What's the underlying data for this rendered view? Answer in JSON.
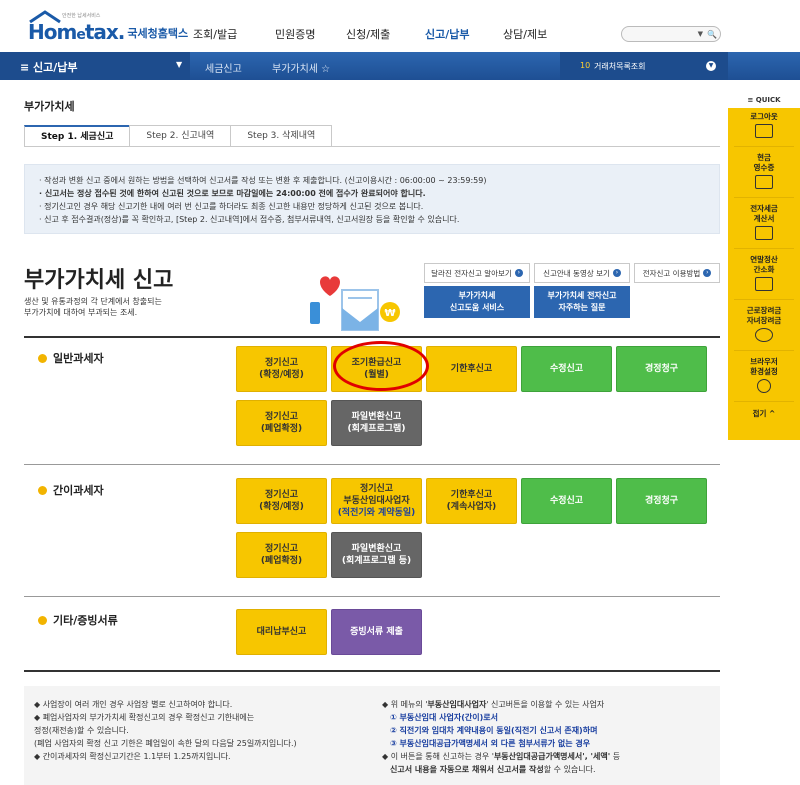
{
  "header": {
    "logo_tag": "안전한 납세서비스",
    "logo_home": "Hom",
    "logo_e": "e",
    "logo_tax": "tax.",
    "logo_sub": "국세청홈택스",
    "nav": [
      "조회/발급",
      "민원증명",
      "신청/제출",
      "신고/납부",
      "상담/제보"
    ],
    "search_placeholder": ""
  },
  "bluebar": {
    "menu_label": "≡  신고/납부",
    "crumbs": [
      "세금신고",
      "부가가치세 ☆"
    ],
    "count": "10",
    "lookup_label": "거래처목록조회"
  },
  "page_title": "부가가치세",
  "tabs": [
    "Step 1. 세금신고",
    "Step 2. 신고내역",
    "Step 3. 삭제내역"
  ],
  "notice": [
    "· 작성과 변환 신고 중에서 원하는 방법을 선택하여 신고서를 작성 또는 변환 후 제출합니다. (신고이용시간 : 06:00:00 ~ 23:59:59)",
    "· 신고서는 정상 접수된 것에 한하여 신고된 것으로 보므로 마감일에는 24:00:00 전에 접수가 완료되어야 합니다.",
    "· 정기신고인 경우 해당 신고기한 내에 여러 번 신고를 하더라도 최종 신고한 내용만 정당하게 신고된 것으로 봅니다.",
    "· 신고 후 접수결과(정상)를 꼭 확인하고, [Step 2. 신고내역]에서 접수증, 첨부서류내역, 신고서원장 등을 확인할 수 있습니다."
  ],
  "vat": {
    "title": "부가가치세 신고",
    "desc_lines": [
      "생산 및 유통과정의 각 단계에서 창출되는",
      "부가가치에 대하여 부과되는 조세."
    ],
    "links": [
      "달라진 전자신고 알아보기",
      "신고안내 동영상 보기",
      "전자신고 이용방법"
    ],
    "blue_buttons": [
      [
        "부가가치세",
        "신고도움 서비스"
      ],
      [
        "부가가치세 전자신고",
        "자주하는 질문"
      ]
    ]
  },
  "sections": {
    "general": {
      "title": "일반과세자",
      "buttons": [
        [
          "정기신고",
          "(확정/예정)"
        ],
        [
          "조기환급신고",
          "(월별)"
        ],
        [
          "기한후신고"
        ],
        [
          "수정신고"
        ],
        [
          "경정청구"
        ],
        [
          "정기신고",
          "(폐업확정)"
        ],
        [
          "파일변환신고",
          "(회계프로그램)"
        ]
      ]
    },
    "simple": {
      "title": "간이과세자",
      "buttons": [
        [
          "정기신고",
          "(확정/예정)"
        ],
        [
          "정기신고",
          "부동산임대사업자",
          "(적전기와 계약동일)"
        ],
        [
          "기한후신고",
          "(계속사업자)"
        ],
        [
          "수정신고"
        ],
        [
          "경정청구"
        ],
        [
          "정기신고",
          "(폐업확정)"
        ],
        [
          "파일변환신고",
          "(회계프로그램 등)"
        ]
      ]
    },
    "other": {
      "title": "기타/증빙서류",
      "buttons": [
        [
          "대리납부신고"
        ],
        [
          "증빙서류 제출"
        ]
      ]
    }
  },
  "bottom_left": [
    "◆ 사업장이 여러 개인 경우 사업장 별로 신고하여야 합니다.",
    "◆ 폐업사업자의 부가가치세 확정신고의 경우 확정신고 기한내에는",
    "   정정(재전송)할 수 있습니다.",
    "   (폐업 사업자의 확정 신고 기한은 폐업일이 속한 달의 다음달 25일까지입니다.)",
    "◆ 간이과세자의 확정신고기간은 1.1부터 1.25까지입니다."
  ],
  "bottom_right": {
    "line1_pre": "◆ 위 메뉴의 '",
    "line1_bold": "부동산임대사업자",
    "line1_post": "' 신고버튼을 이용할 수 있는 사업자",
    "items": [
      "① 부동산임대 사업자(간이)로서",
      "② 직전기와 임대차 계약내용이 동일(직전기 신고서 존재)하며",
      "③ 부동산임대공급가액명세서 외 다른 첨부서류가 없는 경우"
    ],
    "line5_pre": "◆ 이 버튼을 통해 신고하는 경우 '",
    "line5_bold": "부동산임대공급가액명세서', '세액'",
    "line5_post": " 등",
    "line6_bold": "신고서 내용을 자동으로 채워서 신고서를 작성",
    "line6_post": "할 수 있습니다."
  },
  "quick": {
    "title": "≡ QUICK",
    "items": [
      "로그아웃",
      "현금\n영수증",
      "전자세금\n계산서",
      "연말정산\n간소화",
      "근로장려금\n자녀장려금",
      "브라우저\n환경설정"
    ],
    "fold": "접기 ^"
  }
}
